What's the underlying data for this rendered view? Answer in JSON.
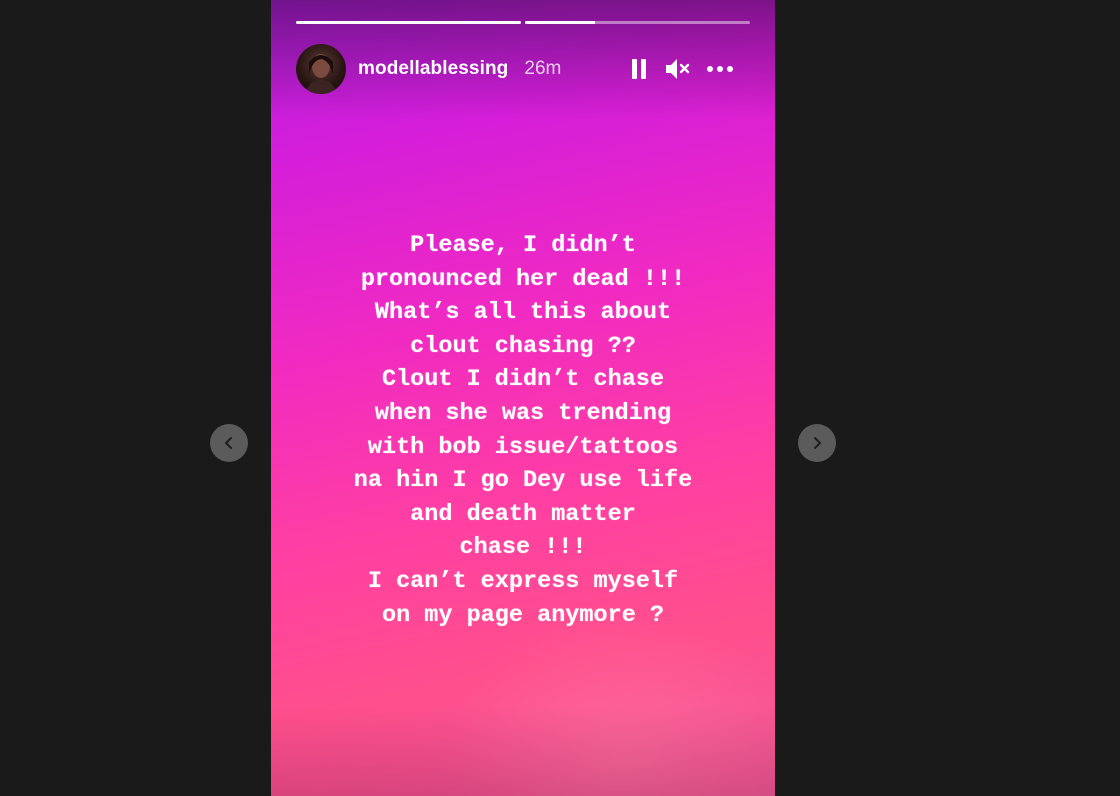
{
  "story": {
    "username": "modellablessing",
    "time_ago": "26m",
    "progress": [
      1.0,
      0.31
    ],
    "lines": [
      "Please, I didn’t",
      "pronounced her dead !!!",
      "What’s all this about",
      "clout chasing ??",
      "Clout I didn’t chase",
      "when she was trending",
      "with bob issue/tattoos",
      "na hin I go Dey use life",
      "and death matter",
      "chase !!!",
      "I can’t express myself",
      "on my page anymore ?"
    ]
  },
  "controls": {
    "pause_icon": "pause-icon",
    "mute_icon": "muted-speaker-icon",
    "more_icon": "more-options-icon"
  },
  "navigation": {
    "prev_icon": "chevron-left-icon",
    "next_icon": "chevron-right-icon"
  },
  "colors": {
    "gradient_top": "#b61fe3",
    "gradient_mid": "#f02ac2",
    "gradient_bottom": "#ff4f8c",
    "viewer_background": "#1a1a1a",
    "nav_button": "#5b5b5b"
  }
}
